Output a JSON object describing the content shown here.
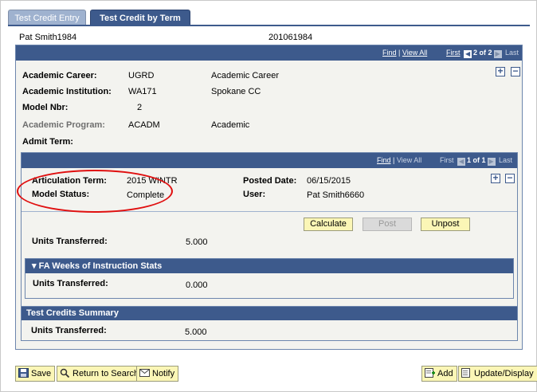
{
  "tabs": [
    {
      "label": "Test Credit Entry"
    },
    {
      "label": "Test Credit by Term"
    }
  ],
  "header": {
    "name": "Pat Smith1984",
    "id": "201061984"
  },
  "outer_nav": {
    "find": "Find",
    "view_all": "View All",
    "first": "First",
    "counter": "2 of 2",
    "last": "Last"
  },
  "fields": {
    "career_label": "Academic Career:",
    "career_code": "UGRD",
    "career_desc": "Academic Career",
    "institution_label": "Academic Institution:",
    "institution_code": "WA171",
    "institution_desc": "Spokane CC",
    "model_nbr_label": "Model Nbr:",
    "model_nbr": "2",
    "program_label": "Academic Program:",
    "program_code": "ACADM",
    "program_desc": "Academic",
    "admit_term_label": "Admit Term:"
  },
  "inner_nav": {
    "find": "Find",
    "view_all": "View All",
    "first": "First",
    "counter": "1 of 1",
    "last": "Last"
  },
  "articulation": {
    "term_label": "Articulation Term:",
    "term_value": "2015 WINTR",
    "posted_label": "Posted Date:",
    "posted_value": "06/15/2015",
    "status_label": "Model Status:",
    "status_value": "Complete",
    "user_label": "User:",
    "user_value": "Pat Smith6660"
  },
  "actions": {
    "calculate": "Calculate",
    "post": "Post",
    "unpost": "Unpost"
  },
  "units": {
    "label": "Units Transferred:",
    "value": "5.000"
  },
  "fa_weeks": {
    "title": "FA Weeks of Instruction Stats",
    "label": "Units Transferred:",
    "value": "0.000"
  },
  "summary": {
    "title": "Test Credits Summary",
    "label": "Units Transferred:",
    "value": "5.000"
  },
  "footer": {
    "save": "Save",
    "return": "Return to Search",
    "notify": "Notify",
    "add": "Add",
    "update": "Update/Display"
  },
  "colors": {
    "accent": "#3d5a8c",
    "button": "#fbf6b6",
    "annotation": "#e01010"
  }
}
